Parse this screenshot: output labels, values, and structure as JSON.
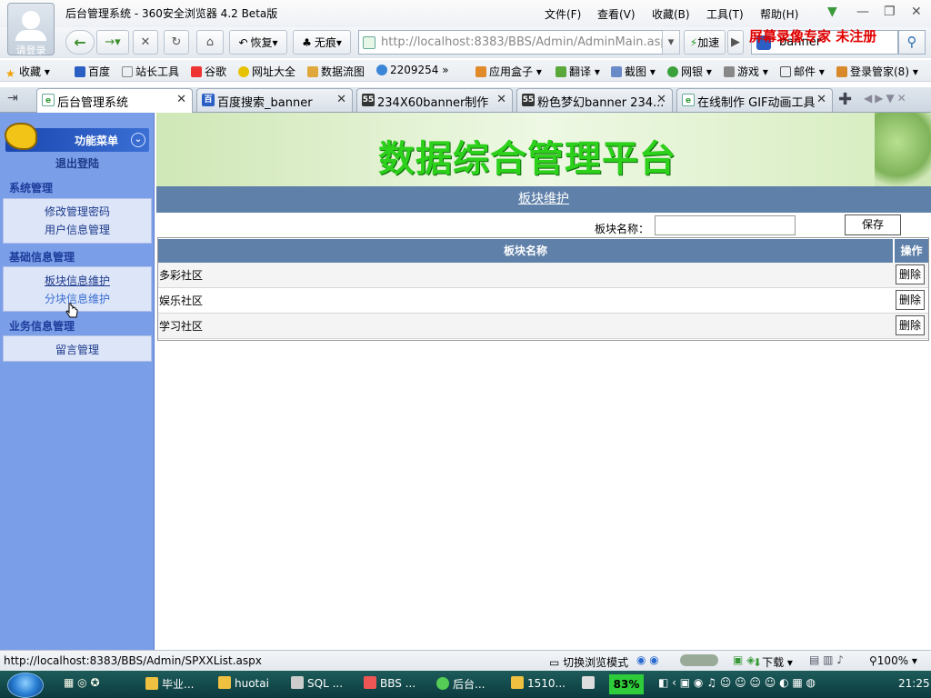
{
  "browser": {
    "window_title": "后台管理系统 - 360安全浏览器 4.2 Beta版",
    "login_label": "请登录",
    "menus": [
      "文件(F)",
      "查看(V)",
      "收藏(B)",
      "工具(T)",
      "帮助(H)"
    ],
    "nav": {
      "restore_label": "恢复",
      "notrace_label": "无痕",
      "address": "http://localhost:8383/BBS/Admin/AdminMain.asp",
      "speed_label": "加速",
      "search_value": "banner",
      "watermark": "屏幕录像专家  未注册"
    },
    "bookmarks": [
      "收藏",
      "百度",
      "站长工具",
      "谷歌",
      "网址大全",
      "数据流图",
      "2209254",
      "应用盒子",
      "翻译",
      "截图",
      "网银",
      "游戏",
      "邮件",
      "登录管家(8)"
    ],
    "tabs": [
      {
        "label": "后台管理系统",
        "active": true
      },
      {
        "label": "百度搜索_banner",
        "active": false
      },
      {
        "label": "234X60banner制作",
        "active": false
      },
      {
        "label": "粉色梦幻banner 234...",
        "active": false
      },
      {
        "label": "在线制作 GIF动画工具",
        "active": false
      }
    ]
  },
  "sidebar": {
    "header": "功能菜单",
    "logout": "退出登陆",
    "groups": [
      {
        "title": "系统管理",
        "items": [
          "修改管理密码",
          "用户信息管理"
        ]
      },
      {
        "title": "基础信息管理",
        "items": [
          "板块信息维护",
          "分块信息维护"
        ]
      },
      {
        "title": "业务信息管理",
        "items": [
          "留言管理"
        ]
      }
    ]
  },
  "main": {
    "banner_title": "数据综合管理平台",
    "section_title": "板块维护",
    "form": {
      "label": "板块名称：",
      "input_value": "",
      "save_label": "保存"
    },
    "table": {
      "headers": [
        "板块名称",
        "操作"
      ],
      "rows": [
        {
          "name": "多彩社区",
          "action": "删除"
        },
        {
          "name": "娱乐社区",
          "action": "删除"
        },
        {
          "name": "学习社区",
          "action": "删除"
        }
      ]
    }
  },
  "statusbar": {
    "url": "http://localhost:8383/BBS/Admin/SPXXList.aspx",
    "mode_label": "切换浏览模式",
    "download_label": "下载",
    "zoom": "100%"
  },
  "taskbar": {
    "tasks": [
      "毕业...",
      "huotai",
      "SQL ...",
      "BBS ...",
      "后台...",
      "1510..."
    ],
    "cpu": "83%",
    "clock": "21:25"
  },
  "colors": {
    "sidebar_bg": "#7b9ee8",
    "header_blue": "#5f80a9",
    "banner_green": "#2dd11c",
    "watermark_red": "#e00000"
  }
}
